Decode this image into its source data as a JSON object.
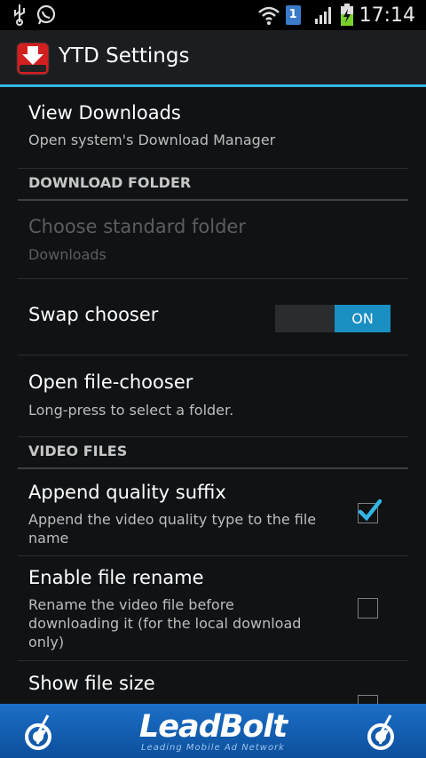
{
  "status_bar": {
    "time": "17:14",
    "sim_slot": "1",
    "icons": [
      "usb-icon",
      "whatsapp-icon",
      "wifi-icon",
      "signal-icon",
      "battery-charging-icon"
    ]
  },
  "action_bar": {
    "title": "YTD Settings",
    "accent_color": "#33b5e5"
  },
  "preferences": {
    "view_downloads": {
      "title": "View Downloads",
      "summary": "Open system's Download Manager"
    },
    "download_folder_header": "DOWNLOAD FOLDER",
    "choose_folder": {
      "title": "Choose standard folder",
      "summary": "Downloads",
      "enabled": false
    },
    "swap_chooser": {
      "title": "Swap chooser",
      "switch_label": "ON",
      "on": true
    },
    "open_file_chooser": {
      "title": "Open file-chooser",
      "summary": "Long-press to select a folder."
    },
    "video_files_header": "VIDEO FILES",
    "append_quality": {
      "title": "Append quality suffix",
      "summary": "Append the video quality type to the file name",
      "checked": true
    },
    "enable_rename": {
      "title": "Enable file rename",
      "summary": "Rename the video file before downloading it (for the local download only)",
      "checked": false
    },
    "show_file_size": {
      "title": "Show file size",
      "checked": false
    }
  },
  "ad_banner": {
    "brand": "LeadBolt",
    "tagline": "Leading Mobile Ad Network",
    "color": "#1b6fc7"
  }
}
